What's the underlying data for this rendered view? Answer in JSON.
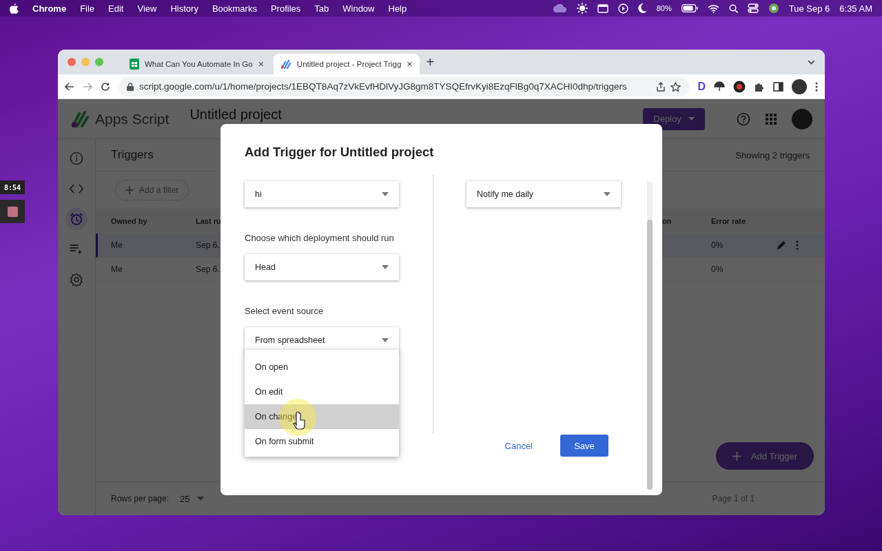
{
  "menu_bar": {
    "app": "Chrome",
    "items": [
      "File",
      "Edit",
      "View",
      "History",
      "Bookmarks",
      "Profiles",
      "Tab",
      "Window",
      "Help"
    ],
    "battery": "80%",
    "date": "Tue Sep 6",
    "time": "6:35 AM"
  },
  "recorder": {
    "timer": "8:54"
  },
  "browser": {
    "tabs": [
      {
        "title": "What Can You Automate In Go",
        "close": "×",
        "selected": false
      },
      {
        "title": "Untitled project - Project Trigg",
        "close": "×",
        "selected": true
      }
    ],
    "new_tab": "+",
    "url": "script.google.com/u/1/home/projects/1EBQT8Aq7zVkEvfHDlVyJG8gm8TYSQEfrvKyi8EzqFlBg0q7XACHI0dhp/triggers",
    "extension_label": "D"
  },
  "app": {
    "name": "Apps Script",
    "project": "Untitled project",
    "deploy": "Deploy",
    "sidebar": [
      {
        "kind": "info",
        "selected": false
      },
      {
        "kind": "code",
        "selected": false
      },
      {
        "kind": "triggers",
        "selected": true
      },
      {
        "kind": "executions",
        "selected": false
      },
      {
        "kind": "settings",
        "selected": false
      }
    ]
  },
  "triggers": {
    "title": "Triggers",
    "count_label": "Showing 2 triggers",
    "filter": "Add a filter",
    "columns": [
      "Owned by",
      "Last ru",
      "on",
      "Error rate"
    ],
    "rows": [
      {
        "owner": "Me",
        "last_run": "Sep 6.",
        "error_rate": "0%",
        "selected": true
      },
      {
        "owner": "Me",
        "last_run": "Sep 6.",
        "error_rate": "0%",
        "selected": false
      }
    ],
    "rows_per_page_label": "Rows per page:",
    "rows_per_page": "25",
    "pagination": "Page 1 of 1",
    "add_button": "Add Trigger"
  },
  "dialog": {
    "title": "Add Trigger for Untitled project",
    "left_fields": [
      {
        "value": "hi"
      },
      {
        "label": "Choose which deployment should run",
        "value": "Head"
      },
      {
        "label": "Select event source",
        "value": "From spreadsheet",
        "expanded": true,
        "options": [
          {
            "label": "On open",
            "selected": false
          },
          {
            "label": "On edit",
            "selected": false
          },
          {
            "label": "On change",
            "selected": true
          },
          {
            "label": "On form submit",
            "selected": false
          }
        ]
      }
    ],
    "right_fields": [
      {
        "value": "Notify me daily"
      }
    ],
    "cancel": "Cancel",
    "save": "Save"
  }
}
